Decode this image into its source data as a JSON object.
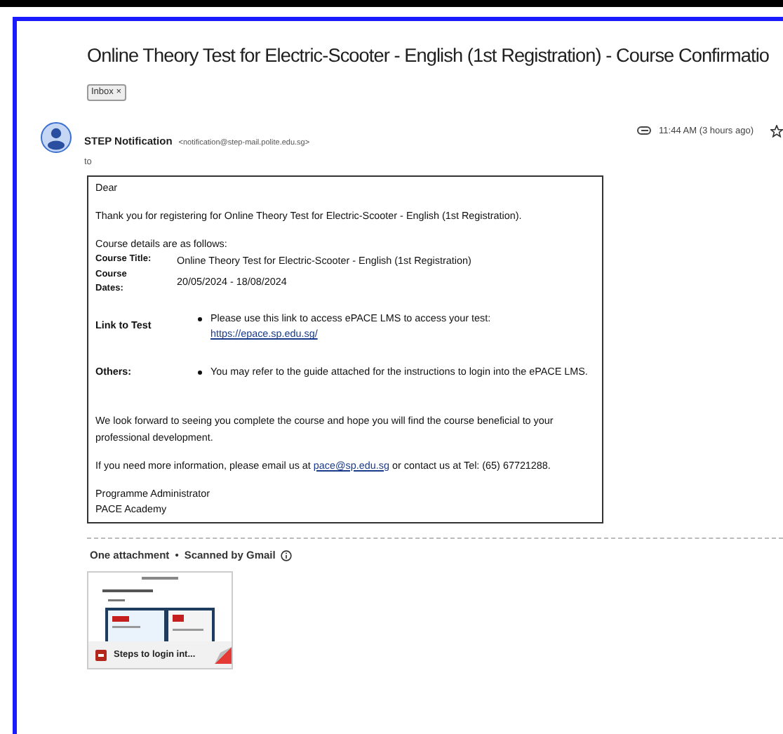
{
  "subject": "Online Theory Test for Electric-Scooter - English (1st Registration) - Course Confirmatio",
  "label_chip": {
    "text": "Inbox",
    "close": "×"
  },
  "sender": {
    "name": "STEP Notification",
    "email": "<notification@step-mail.polite.edu.sg>",
    "to": "to"
  },
  "time": "11:44 AM (3 hours ago)",
  "starred": false,
  "body": {
    "greeting": "Dear",
    "intro": "Thank you for registering for Online Theory Test for Electric-Scooter - English (1st Registration).",
    "details_heading": "Course details are as follows:",
    "details": [
      {
        "label": "Course Title:",
        "value": "Online Theory Test for Electric-Scooter - English (1st Registration)"
      },
      {
        "label": "Course Dates:",
        "value": "20/05/2024 - 18/08/2024"
      }
    ],
    "info": [
      {
        "label": "Link to Test",
        "text": "Please use this link to access ePACE LMS to access your test:",
        "link": "https://epace.sp.edu.sg/"
      },
      {
        "label": "Others:",
        "text": "You may refer to the guide attached for the instructions to login into the ePACE LMS."
      }
    ],
    "closing": "We look forward to seeing you complete the course and hope you will find the course beneficial to your professional development.",
    "contact": {
      "before": "If you need more information, please email us at ",
      "link": "pace@sp.edu.sg",
      "after": " or contact us at Tel: (65) 67721288."
    },
    "signature": [
      "Programme Administrator",
      "PACE Academy"
    ]
  },
  "attachments": {
    "summary": "One attachment",
    "separator": "•",
    "scan": "Scanned by Gmail",
    "items": [
      {
        "name": "Steps to login int..."
      }
    ]
  }
}
